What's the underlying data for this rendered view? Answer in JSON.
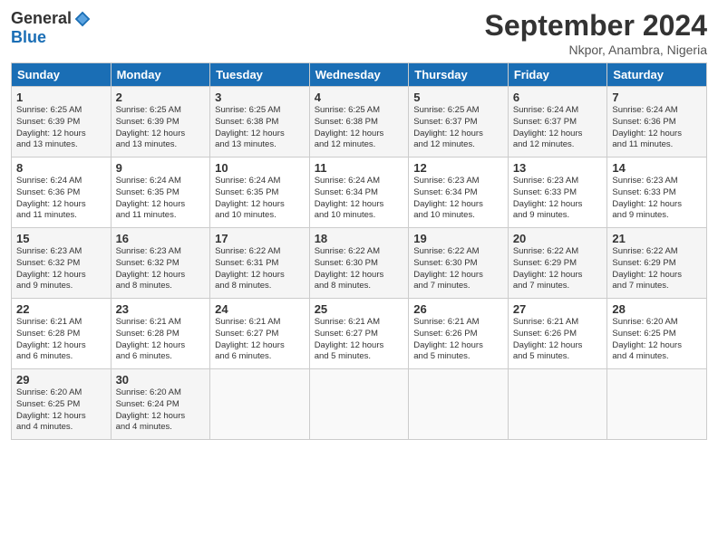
{
  "header": {
    "logo_general": "General",
    "logo_blue": "Blue",
    "month_title": "September 2024",
    "location": "Nkpor, Anambra, Nigeria"
  },
  "weekdays": [
    "Sunday",
    "Monday",
    "Tuesday",
    "Wednesday",
    "Thursday",
    "Friday",
    "Saturday"
  ],
  "weeks": [
    [
      {
        "day": "1",
        "info": "Sunrise: 6:25 AM\nSunset: 6:39 PM\nDaylight: 12 hours\nand 13 minutes."
      },
      {
        "day": "2",
        "info": "Sunrise: 6:25 AM\nSunset: 6:39 PM\nDaylight: 12 hours\nand 13 minutes."
      },
      {
        "day": "3",
        "info": "Sunrise: 6:25 AM\nSunset: 6:38 PM\nDaylight: 12 hours\nand 13 minutes."
      },
      {
        "day": "4",
        "info": "Sunrise: 6:25 AM\nSunset: 6:38 PM\nDaylight: 12 hours\nand 12 minutes."
      },
      {
        "day": "5",
        "info": "Sunrise: 6:25 AM\nSunset: 6:37 PM\nDaylight: 12 hours\nand 12 minutes."
      },
      {
        "day": "6",
        "info": "Sunrise: 6:24 AM\nSunset: 6:37 PM\nDaylight: 12 hours\nand 12 minutes."
      },
      {
        "day": "7",
        "info": "Sunrise: 6:24 AM\nSunset: 6:36 PM\nDaylight: 12 hours\nand 11 minutes."
      }
    ],
    [
      {
        "day": "8",
        "info": "Sunrise: 6:24 AM\nSunset: 6:36 PM\nDaylight: 12 hours\nand 11 minutes."
      },
      {
        "day": "9",
        "info": "Sunrise: 6:24 AM\nSunset: 6:35 PM\nDaylight: 12 hours\nand 11 minutes."
      },
      {
        "day": "10",
        "info": "Sunrise: 6:24 AM\nSunset: 6:35 PM\nDaylight: 12 hours\nand 10 minutes."
      },
      {
        "day": "11",
        "info": "Sunrise: 6:24 AM\nSunset: 6:34 PM\nDaylight: 12 hours\nand 10 minutes."
      },
      {
        "day": "12",
        "info": "Sunrise: 6:23 AM\nSunset: 6:34 PM\nDaylight: 12 hours\nand 10 minutes."
      },
      {
        "day": "13",
        "info": "Sunrise: 6:23 AM\nSunset: 6:33 PM\nDaylight: 12 hours\nand 9 minutes."
      },
      {
        "day": "14",
        "info": "Sunrise: 6:23 AM\nSunset: 6:33 PM\nDaylight: 12 hours\nand 9 minutes."
      }
    ],
    [
      {
        "day": "15",
        "info": "Sunrise: 6:23 AM\nSunset: 6:32 PM\nDaylight: 12 hours\nand 9 minutes."
      },
      {
        "day": "16",
        "info": "Sunrise: 6:23 AM\nSunset: 6:32 PM\nDaylight: 12 hours\nand 8 minutes."
      },
      {
        "day": "17",
        "info": "Sunrise: 6:22 AM\nSunset: 6:31 PM\nDaylight: 12 hours\nand 8 minutes."
      },
      {
        "day": "18",
        "info": "Sunrise: 6:22 AM\nSunset: 6:30 PM\nDaylight: 12 hours\nand 8 minutes."
      },
      {
        "day": "19",
        "info": "Sunrise: 6:22 AM\nSunset: 6:30 PM\nDaylight: 12 hours\nand 7 minutes."
      },
      {
        "day": "20",
        "info": "Sunrise: 6:22 AM\nSunset: 6:29 PM\nDaylight: 12 hours\nand 7 minutes."
      },
      {
        "day": "21",
        "info": "Sunrise: 6:22 AM\nSunset: 6:29 PM\nDaylight: 12 hours\nand 7 minutes."
      }
    ],
    [
      {
        "day": "22",
        "info": "Sunrise: 6:21 AM\nSunset: 6:28 PM\nDaylight: 12 hours\nand 6 minutes."
      },
      {
        "day": "23",
        "info": "Sunrise: 6:21 AM\nSunset: 6:28 PM\nDaylight: 12 hours\nand 6 minutes."
      },
      {
        "day": "24",
        "info": "Sunrise: 6:21 AM\nSunset: 6:27 PM\nDaylight: 12 hours\nand 6 minutes."
      },
      {
        "day": "25",
        "info": "Sunrise: 6:21 AM\nSunset: 6:27 PM\nDaylight: 12 hours\nand 5 minutes."
      },
      {
        "day": "26",
        "info": "Sunrise: 6:21 AM\nSunset: 6:26 PM\nDaylight: 12 hours\nand 5 minutes."
      },
      {
        "day": "27",
        "info": "Sunrise: 6:21 AM\nSunset: 6:26 PM\nDaylight: 12 hours\nand 5 minutes."
      },
      {
        "day": "28",
        "info": "Sunrise: 6:20 AM\nSunset: 6:25 PM\nDaylight: 12 hours\nand 4 minutes."
      }
    ],
    [
      {
        "day": "29",
        "info": "Sunrise: 6:20 AM\nSunset: 6:25 PM\nDaylight: 12 hours\nand 4 minutes."
      },
      {
        "day": "30",
        "info": "Sunrise: 6:20 AM\nSunset: 6:24 PM\nDaylight: 12 hours\nand 4 minutes."
      },
      {
        "day": "",
        "info": ""
      },
      {
        "day": "",
        "info": ""
      },
      {
        "day": "",
        "info": ""
      },
      {
        "day": "",
        "info": ""
      },
      {
        "day": "",
        "info": ""
      }
    ]
  ]
}
